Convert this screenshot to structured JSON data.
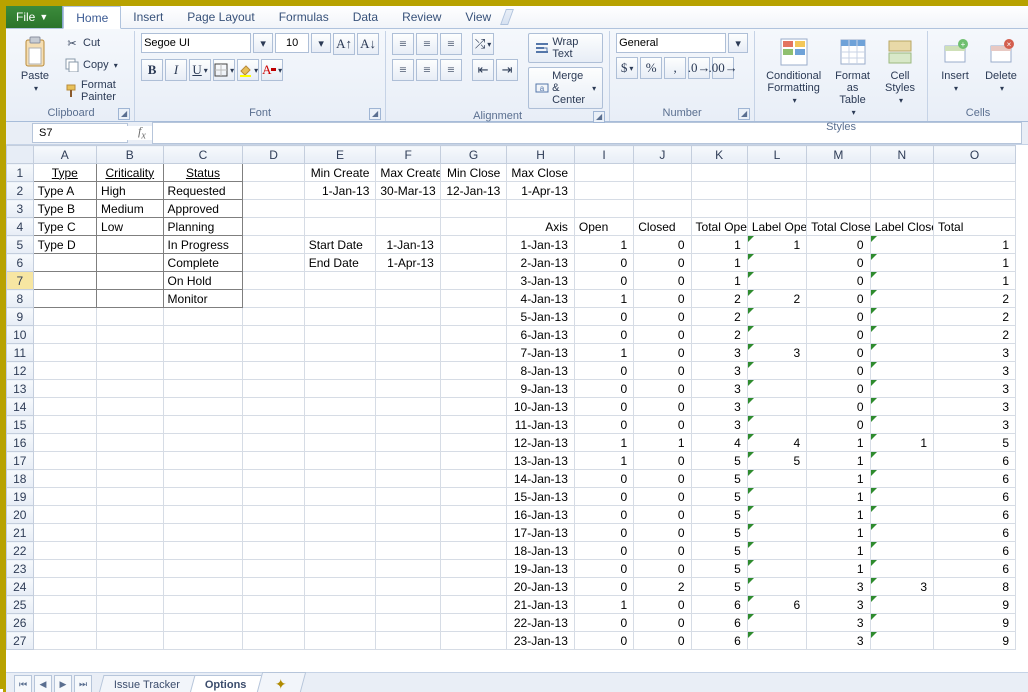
{
  "app": {
    "file_tab": "File",
    "tabs": [
      "Home",
      "Insert",
      "Page Layout",
      "Formulas",
      "Data",
      "Review",
      "View"
    ],
    "active_tab_index": 0
  },
  "ribbon": {
    "clipboard": {
      "label": "Clipboard",
      "paste": "Paste",
      "cut": "Cut",
      "copy": "Copy",
      "format_painter": "Format Painter"
    },
    "font": {
      "label": "Font",
      "family": "Segoe UI",
      "size": "10"
    },
    "alignment": {
      "label": "Alignment",
      "wrap": "Wrap Text",
      "merge": "Merge & Center"
    },
    "number": {
      "label": "Number",
      "format": "General"
    },
    "styles": {
      "label": "Styles",
      "cond": "Conditional\nFormatting",
      "table": "Format\nas Table",
      "cell": "Cell\nStyles"
    },
    "cells": {
      "label": "Cells",
      "insert": "Insert",
      "delete": "Delete"
    }
  },
  "namebox": "S7",
  "formula": "",
  "columns": [
    "A",
    "B",
    "C",
    "D",
    "E",
    "F",
    "G",
    "H",
    "I",
    "J",
    "K",
    "L",
    "M",
    "N",
    "O"
  ],
  "headers": {
    "A": "Type",
    "B": "Criticality",
    "C": "Status",
    "E": "Min Create",
    "F": "Max Create",
    "G": "Min Close",
    "H": "Max Close"
  },
  "summary_dates": {
    "E": "1-Jan-13",
    "F": "30-Mar-13",
    "G": "12-Jan-13",
    "H": "1-Apr-13"
  },
  "box": {
    "A": [
      "Type A",
      "Type B",
      "Type C",
      "Type D",
      "",
      "",
      ""
    ],
    "B": [
      "High",
      "Medium",
      "Low",
      "",
      "",
      "",
      ""
    ],
    "C": [
      "Requested",
      "Approved",
      "Planning",
      "In Progress",
      "Complete",
      "On Hold",
      "Monitor"
    ]
  },
  "labels": {
    "H": "Axis",
    "I": "Open",
    "J": "Closed",
    "K": "Total Open",
    "L": "Label Open",
    "M": "Total Closed",
    "N": "Label Closed",
    "O": "Total"
  },
  "start_date_lbl": "Start Date",
  "end_date_lbl": "End Date",
  "start_date": "1-Jan-13",
  "end_date": "1-Apr-13",
  "rows": [
    {
      "H": "1-Jan-13",
      "I": 1,
      "J": 0,
      "K": 1,
      "L": "1",
      "M": 0,
      "N": "",
      "O": 1
    },
    {
      "H": "2-Jan-13",
      "I": 0,
      "J": 0,
      "K": 1,
      "L": "",
      "M": 0,
      "N": "",
      "O": 1
    },
    {
      "H": "3-Jan-13",
      "I": 0,
      "J": 0,
      "K": 1,
      "L": "",
      "M": 0,
      "N": "",
      "O": 1
    },
    {
      "H": "4-Jan-13",
      "I": 1,
      "J": 0,
      "K": 2,
      "L": "2",
      "M": 0,
      "N": "",
      "O": 2
    },
    {
      "H": "5-Jan-13",
      "I": 0,
      "J": 0,
      "K": 2,
      "L": "",
      "M": 0,
      "N": "",
      "O": 2
    },
    {
      "H": "6-Jan-13",
      "I": 0,
      "J": 0,
      "K": 2,
      "L": "",
      "M": 0,
      "N": "",
      "O": 2
    },
    {
      "H": "7-Jan-13",
      "I": 1,
      "J": 0,
      "K": 3,
      "L": "3",
      "M": 0,
      "N": "",
      "O": 3
    },
    {
      "H": "8-Jan-13",
      "I": 0,
      "J": 0,
      "K": 3,
      "L": "",
      "M": 0,
      "N": "",
      "O": 3
    },
    {
      "H": "9-Jan-13",
      "I": 0,
      "J": 0,
      "K": 3,
      "L": "",
      "M": 0,
      "N": "",
      "O": 3
    },
    {
      "H": "10-Jan-13",
      "I": 0,
      "J": 0,
      "K": 3,
      "L": "",
      "M": 0,
      "N": "",
      "O": 3
    },
    {
      "H": "11-Jan-13",
      "I": 0,
      "J": 0,
      "K": 3,
      "L": "",
      "M": 0,
      "N": "",
      "O": 3
    },
    {
      "H": "12-Jan-13",
      "I": 1,
      "J": 1,
      "K": 4,
      "L": "4",
      "M": 1,
      "N": "1",
      "O": 5
    },
    {
      "H": "13-Jan-13",
      "I": 1,
      "J": 0,
      "K": 5,
      "L": "5",
      "M": 1,
      "N": "",
      "O": 6
    },
    {
      "H": "14-Jan-13",
      "I": 0,
      "J": 0,
      "K": 5,
      "L": "",
      "M": 1,
      "N": "",
      "O": 6
    },
    {
      "H": "15-Jan-13",
      "I": 0,
      "J": 0,
      "K": 5,
      "L": "",
      "M": 1,
      "N": "",
      "O": 6
    },
    {
      "H": "16-Jan-13",
      "I": 0,
      "J": 0,
      "K": 5,
      "L": "",
      "M": 1,
      "N": "",
      "O": 6
    },
    {
      "H": "17-Jan-13",
      "I": 0,
      "J": 0,
      "K": 5,
      "L": "",
      "M": 1,
      "N": "",
      "O": 6
    },
    {
      "H": "18-Jan-13",
      "I": 0,
      "J": 0,
      "K": 5,
      "L": "",
      "M": 1,
      "N": "",
      "O": 6
    },
    {
      "H": "19-Jan-13",
      "I": 0,
      "J": 0,
      "K": 5,
      "L": "",
      "M": 1,
      "N": "",
      "O": 6
    },
    {
      "H": "20-Jan-13",
      "I": 0,
      "J": 2,
      "K": 5,
      "L": "",
      "M": 3,
      "N": "3",
      "O": 8
    },
    {
      "H": "21-Jan-13",
      "I": 1,
      "J": 0,
      "K": 6,
      "L": "6",
      "M": 3,
      "N": "",
      "O": 9
    },
    {
      "H": "22-Jan-13",
      "I": 0,
      "J": 0,
      "K": 6,
      "L": "",
      "M": 3,
      "N": "",
      "O": 9
    },
    {
      "H": "23-Jan-13",
      "I": 0,
      "J": 0,
      "K": 6,
      "L": "",
      "M": 3,
      "N": "",
      "O": 9
    }
  ],
  "sheets": [
    "Issue Tracker",
    "Options"
  ],
  "active_sheet_index": 1
}
